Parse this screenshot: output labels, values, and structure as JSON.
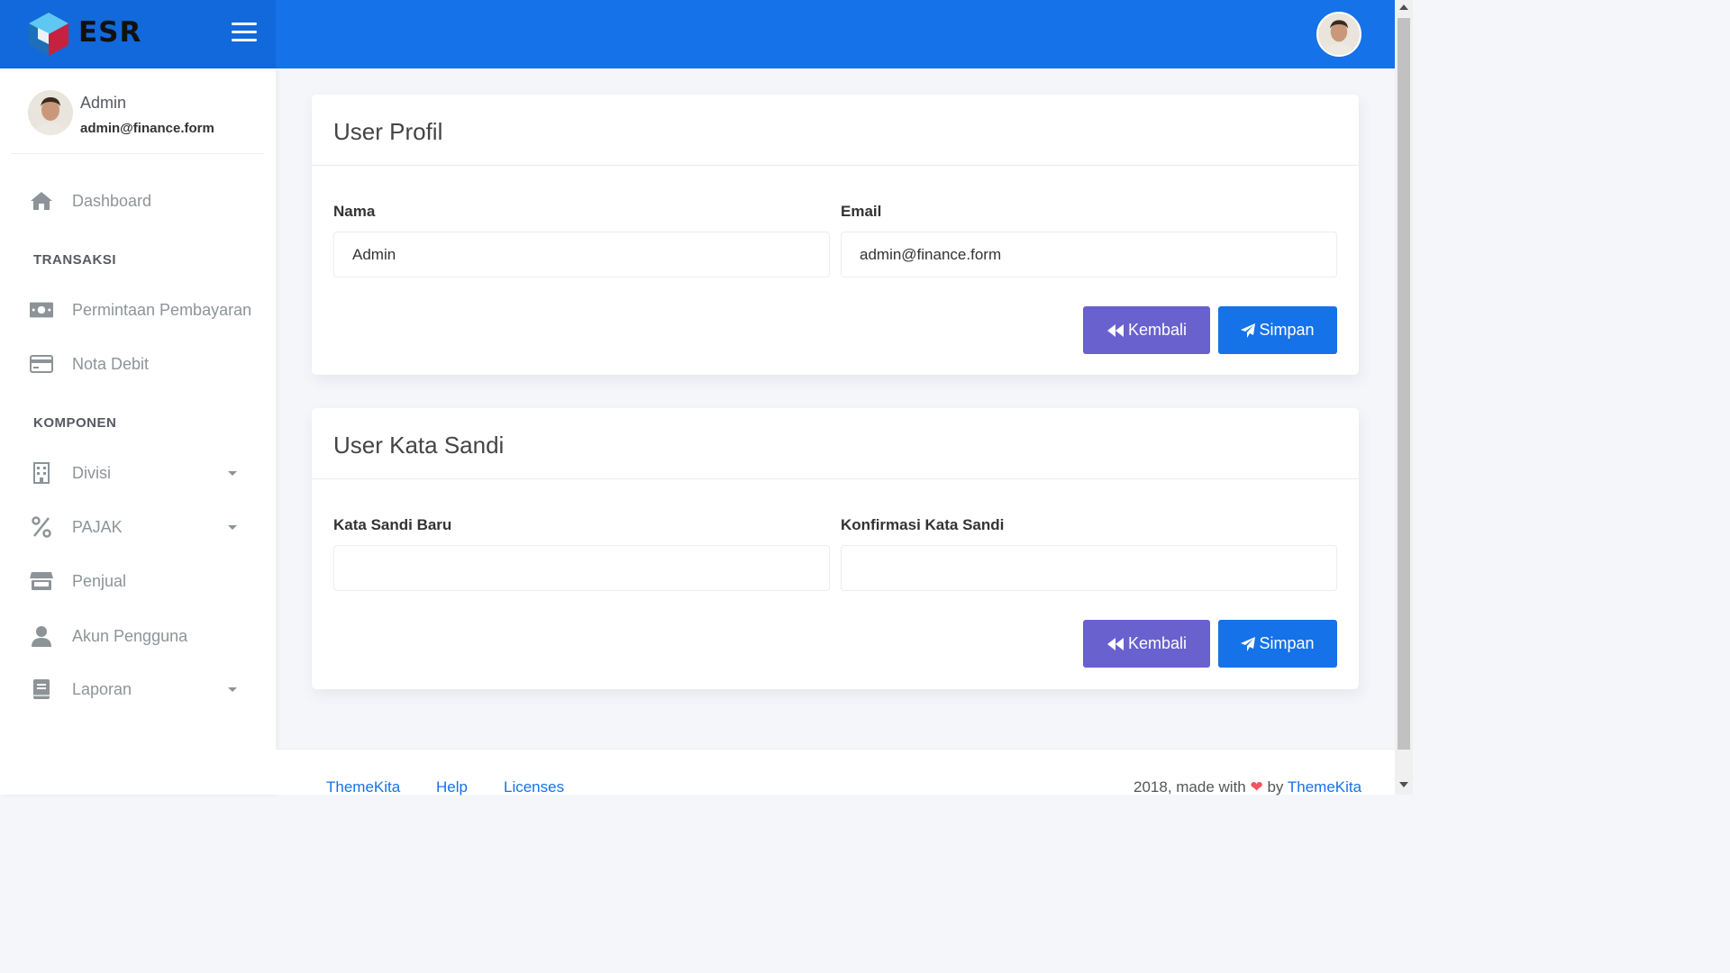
{
  "brand": {
    "name": "ESR",
    "logo_icon": "cube-logo-icon"
  },
  "header": {
    "menu_icon": "hamburger-icon",
    "avatar_icon": "user-avatar"
  },
  "sidebar": {
    "user": {
      "name": "Admin",
      "email": "admin@finance.form"
    },
    "items": [
      {
        "label": "Dashboard",
        "icon": "home-icon"
      },
      {
        "label": "Permintaan Pembayaran",
        "icon": "money-icon"
      },
      {
        "label": "Nota Debit",
        "icon": "credit-card-icon"
      },
      {
        "label": "Divisi",
        "icon": "building-icon",
        "has_caret": true
      },
      {
        "label": "PAJAK",
        "icon": "percent-icon",
        "has_caret": true
      },
      {
        "label": "Penjual",
        "icon": "store-icon"
      },
      {
        "label": "Akun Pengguna",
        "icon": "user-icon"
      },
      {
        "label": "Laporan",
        "icon": "book-icon",
        "has_caret": true
      }
    ],
    "sections": {
      "transaksi": "TRANSAKSI",
      "komponen": "KOMPONEN"
    }
  },
  "profile_card": {
    "title": "User Profil",
    "name_label": "Nama",
    "name_value": "Admin",
    "email_label": "Email",
    "email_value": "admin@finance.form",
    "back_label": "Kembali",
    "save_label": "Simpan"
  },
  "password_card": {
    "title": "User Kata Sandi",
    "new_label": "Kata Sandi Baru",
    "new_value": "",
    "confirm_label": "Konfirmasi Kata Sandi",
    "confirm_value": "",
    "back_label": "Kembali",
    "save_label": "Simpan"
  },
  "footer": {
    "links": [
      "ThemeKita",
      "Help",
      "Licenses"
    ],
    "copyright_prefix": "2018, made with",
    "copyright_by": "by",
    "copyright_link": "ThemeKita"
  },
  "colors": {
    "primary": "#1572e8",
    "secondary": "#6861ce",
    "heart": "#f3545d"
  }
}
